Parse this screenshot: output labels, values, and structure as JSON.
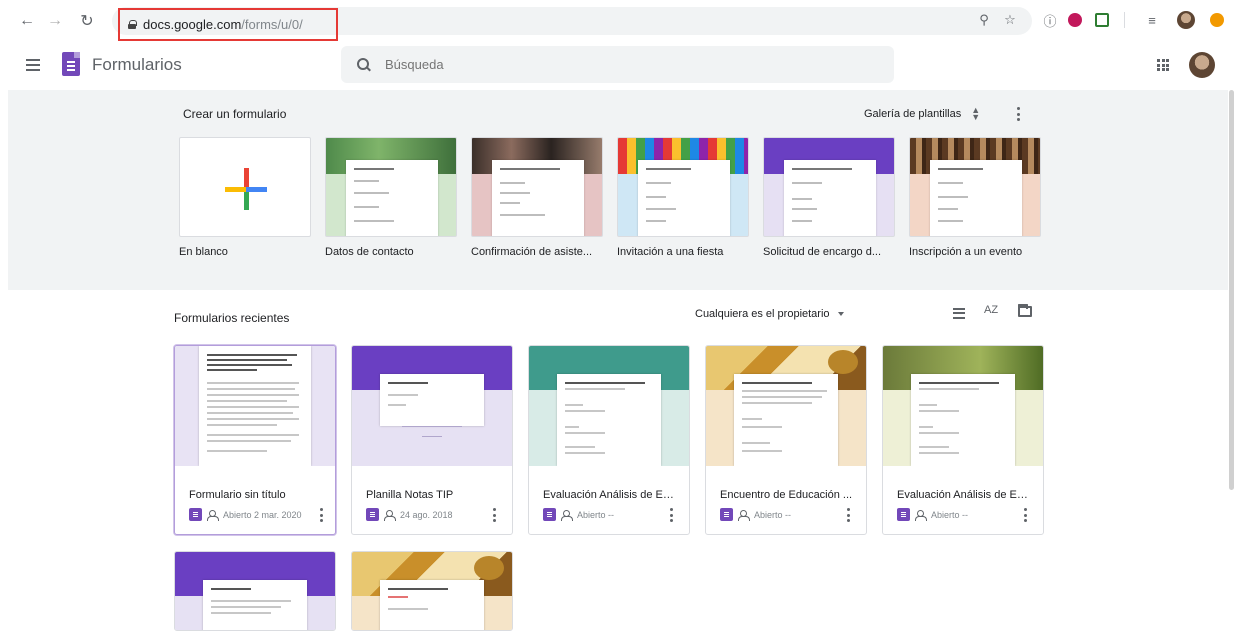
{
  "browser": {
    "url_host": "docs.google.com",
    "url_path": "/forms/u/0/"
  },
  "app": {
    "title": "Formularios",
    "search_placeholder": "Búsqueda"
  },
  "gallery": {
    "title": "Crear un formulario",
    "templates_link": "Galería de plantillas",
    "templates": [
      {
        "label": "En blanco"
      },
      {
        "label": "Datos de contacto",
        "color": "#d2e7cd"
      },
      {
        "label": "Confirmación de asiste...",
        "color": "#e6c4c4"
      },
      {
        "label": "Invitación a una fiesta",
        "color": "#cfe7f5"
      },
      {
        "label": "Solicitud de encargo d...",
        "color": "#e6e0f3"
      },
      {
        "label": "Inscripción a un evento",
        "color": "#f3d6c6"
      }
    ]
  },
  "recent": {
    "title": "Formularios recientes",
    "owner_filter": "Cualquiera es el propietario",
    "sort_label": "AZ",
    "forms": [
      {
        "title": "Formulario sin título",
        "meta": "Abierto 2 mar. 2020",
        "color": "#e8e3f4"
      },
      {
        "title": "Planilla Notas TIP",
        "meta": "24 ago. 2018",
        "color": "#e6e1f3"
      },
      {
        "title": "Evaluación Análisis de Ent...",
        "meta": "Abierto --",
        "color": "#d8ebe7"
      },
      {
        "title": "Encuentro de Educación ...",
        "meta": "Abierto --",
        "color": "#f5e4c8"
      },
      {
        "title": "Evaluación Análisis de Ent...",
        "meta": "Abierto --",
        "color": "#eef0d6"
      }
    ]
  },
  "colors": {
    "forms_purple": "#7248b9",
    "teal": "#3f9b8c",
    "olive": "#8a9a4a",
    "url_highlight": "#e53935"
  }
}
